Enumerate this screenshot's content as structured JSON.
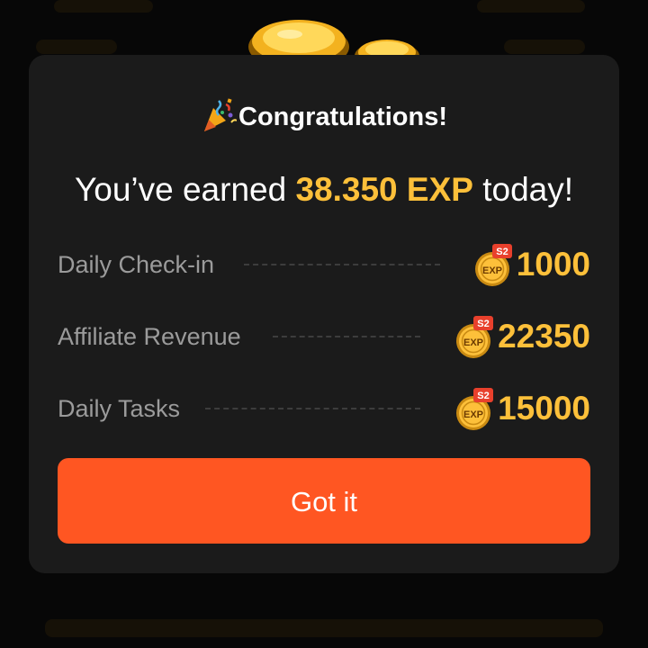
{
  "dialog": {
    "title": "Congratulations!",
    "earned_prefix": "You’ve earned ",
    "earned_amount": "38.350 EXP",
    "earned_suffix": " today!",
    "title_icon": "party-popper-icon"
  },
  "rewards": [
    {
      "label": "Daily Check-in",
      "value": "1000",
      "badge_text": "EXP",
      "badge_tag": "S2",
      "icon": "exp-coin-icon"
    },
    {
      "label": "Affiliate Revenue",
      "value": "22350",
      "badge_text": "EXP",
      "badge_tag": "S2",
      "icon": "exp-coin-icon"
    },
    {
      "label": "Daily Tasks",
      "value": "15000",
      "badge_text": "EXP",
      "badge_tag": "S2",
      "icon": "exp-coin-icon"
    }
  ],
  "button": {
    "label": "Got it"
  },
  "colors": {
    "accent_gold": "#fdc03a",
    "button_orange": "#ff5622",
    "modal_bg": "#1b1b1b",
    "label_gray": "#9b9b9b",
    "badge_red": "#e8402c"
  }
}
